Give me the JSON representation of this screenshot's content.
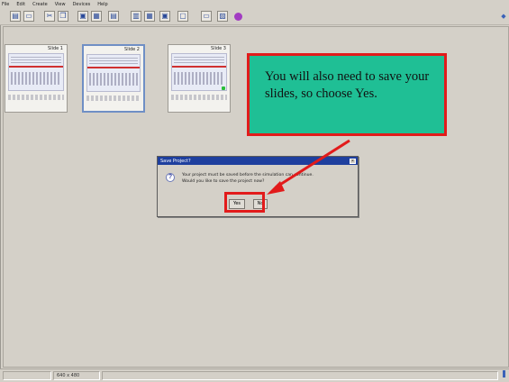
{
  "menubar": {
    "items": [
      "File",
      "Edit",
      "Create",
      "View",
      "Devices",
      "Help"
    ]
  },
  "toolbar": {
    "buttons": [
      {
        "name": "toolbar-new-icon",
        "glyph": "▤"
      },
      {
        "name": "toolbar-open-icon",
        "glyph": "▭"
      },
      {
        "name": "toolbar-cut-icon",
        "glyph": "✂"
      },
      {
        "name": "toolbar-copy-icon",
        "glyph": "❐"
      },
      {
        "name": "toolbar-paste-icon",
        "glyph": "▣"
      },
      {
        "name": "toolbar-image-icon",
        "glyph": "▦"
      },
      {
        "name": "toolbar-properties-icon",
        "glyph": "▤"
      },
      {
        "name": "toolbar-slides-icon",
        "glyph": "▥"
      },
      {
        "name": "toolbar-grid-icon",
        "glyph": "▦"
      },
      {
        "name": "toolbar-capture-icon",
        "glyph": "▣"
      },
      {
        "name": "toolbar-monitor-icon",
        "glyph": "▢"
      },
      {
        "name": "toolbar-window-icon",
        "glyph": "▭"
      },
      {
        "name": "toolbar-export-icon",
        "glyph": "▨"
      },
      {
        "name": "toolbar-run-icon",
        "glyph": ""
      }
    ]
  },
  "slides": [
    {
      "title": "Slide 1"
    },
    {
      "title": "Slide 2"
    },
    {
      "title": "Slide 3"
    }
  ],
  "callout": {
    "text": "You will also need to save your slides, so choose Yes."
  },
  "dialog": {
    "title": "Save Project?",
    "line1": "Your project must be saved before the simulation can continue.",
    "line2": "Would you like to save the project now?",
    "yes_label": "Yes",
    "no_label": "No"
  },
  "statusbar": {
    "left": "",
    "size": "640 x 480"
  },
  "colors": {
    "callout_fill": "#1fbf95",
    "highlight_red": "#e21b1b",
    "dialog_title": "#1e3f9e"
  }
}
